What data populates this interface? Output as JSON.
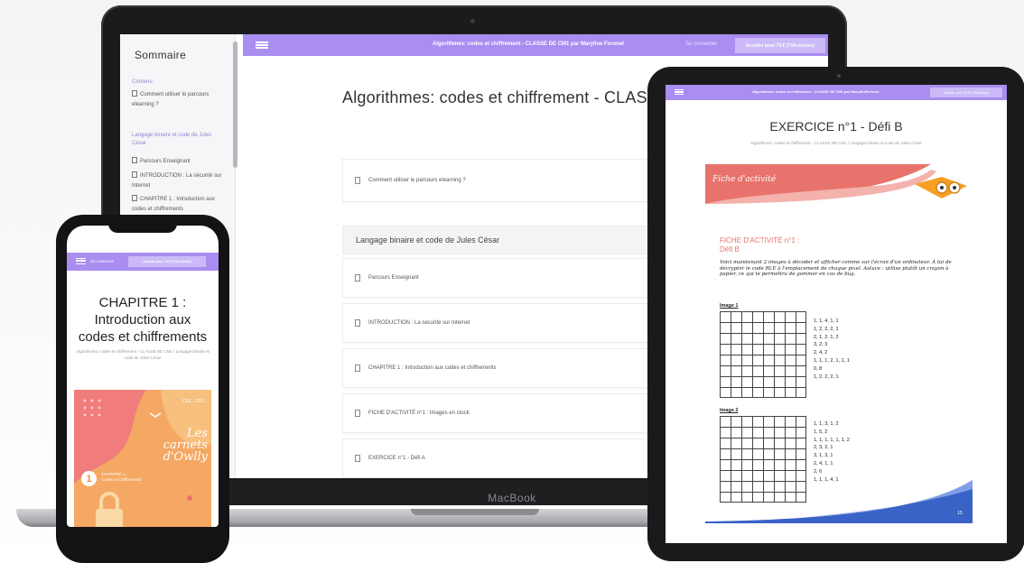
{
  "laptop": {
    "brand": "MacBook",
    "sidebar": {
      "title": "Sommaire",
      "sections": [
        {
          "label": "Contenu",
          "items": [
            "Comment utiliser le parcours elearning ?"
          ]
        },
        {
          "label": "Langage binaire et code de Jules César",
          "items": [
            "Parcours Enseignant",
            "INTRODUCTION : La sécurité sur Internet",
            "CHAPITRE 1 : Introduction aux codes et chiffrements"
          ]
        }
      ]
    },
    "topbar": {
      "title": "Algorithmes: codes et chiffrement - CLASSE DE CM1 par Maryline Forsnet",
      "login": "Se connecter",
      "cta": "Accéder pour 73 € (TVA incluse)"
    },
    "page_title": "Algorithmes: codes et chiffrement - CLAS",
    "first_item": "Comment utiliser le parcours elearning ?",
    "section_title": "Langage binaire et code de Jules César",
    "items": [
      "Parcours Enseignant",
      "INTRODUCTION : La sécurité sur Internet",
      "CHAPITRE 1 : Introduction aux codes et chiffrements",
      "FICHE D'ACTIVITÉ n°1 : Images en stock",
      "EXERCICE n°1 - Défi A"
    ]
  },
  "tablet": {
    "topbar_title": "Algorithmes: codes et chiffrement - CLASSE DE CM1 par MaryfineForsnet",
    "topbar_cta": "Accéder pour 73 € (TVA incluse)",
    "title": "EXERCICE n°1 - Défi B",
    "breadcrumb": "Algorithmes: codes et chiffrement - CLASSE DE CM1 / Langage binaire et code de Jules César",
    "sheet": {
      "banner": "Fiche d'activité",
      "heading_line1": "FICHE D'ACTIVITÉ n°1 :",
      "heading_line2": "Défi B",
      "instruction": "Voici maintenant 2 images à décoder et afficher comme sur l'écran d'un ordinateur. À toi de décrypter le code RLE à l'emplacement de chaque pixel. Astuce : utilise plutôt un crayon à papier, ce qui te permettra de gommer en cas de bug.",
      "image1_label": "Image 1",
      "image1_codes": [
        "1, 1, 4, 1, 1",
        "1, 2, 2, 2, 1",
        "2, 1, 2, 1, 2",
        "3, 2, 3",
        "2, 4, 2",
        "1, 1, 1, 2, 1, 1, 1",
        "0, 8",
        "1, 2, 2, 2, 1"
      ],
      "image2_label": "Image 2",
      "image2_codes": [
        "1, 1, 3, 1, 2",
        "1, 5, 2",
        "1, 1, 1, 1, 1, 1, 2",
        "2, 3, 2, 1",
        "3, 1, 3, 1",
        "2, 4, 1, 1",
        "2, 6",
        "1, 1, 1, 4, 1"
      ],
      "page_number": "15"
    }
  },
  "phone": {
    "login": "Se connecter",
    "cta": "Accéder pour 73 € (TVA incluse)",
    "title_lines": [
      "CHAPITRE 1 :",
      "Introduction aux",
      "codes et chiffrements"
    ],
    "breadcrumb": "Algorithmes: codes et chiffrement - CLASSE DE CM1 / Langage binaire et code de Jules César",
    "cover": {
      "title_line1": "Les carnets",
      "title_line2": "d'Owlly",
      "number": "1",
      "chapter_line1": "CHAPITRE 1 :",
      "chapter_line2": "Codes et Chiffrements",
      "badge": "CE1 · CE2"
    }
  },
  "colors": {
    "accent": "#a98df0",
    "accent_light": "#cbbaf7",
    "coral": "#e8736c",
    "orange": "#f5a863"
  }
}
